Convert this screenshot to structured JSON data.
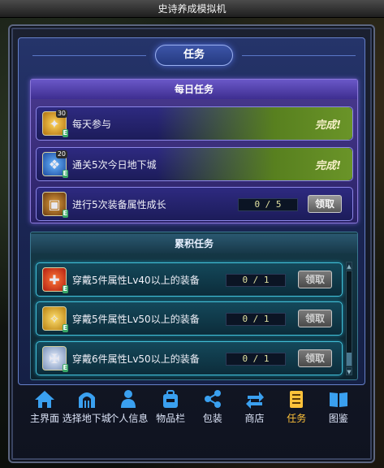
{
  "window": {
    "title": "史诗养成模拟机"
  },
  "panel": {
    "title": "任务"
  },
  "daily": {
    "title": "每日任务",
    "rows": [
      {
        "label": "每天参与",
        "badge": "30",
        "icon": "gold-coin-icon",
        "status": "完成!"
      },
      {
        "label": "通关5次今日地下城",
        "badge": "20",
        "icon": "blue-rune-icon",
        "status": "完成!"
      },
      {
        "label": "进行5次装备属性成长",
        "icon": "equipment-chest-icon",
        "progress": "0 / 5",
        "button": "领取"
      }
    ]
  },
  "accum": {
    "title": "累积任务",
    "rows": [
      {
        "label": "穿戴5件属性Lv40以上的装备",
        "icon": "red-gift-box-icon",
        "progress": "0 / 1",
        "button": "领取"
      },
      {
        "label": "穿戴5件属性Lv50以上的装备",
        "icon": "gold-armor-icon",
        "progress": "0 / 1",
        "button": "领取"
      },
      {
        "label": "穿戴6件属性Lv50以上的装备",
        "icon": "silver-crest-icon",
        "progress": "0 / 1",
        "button": "领取"
      }
    ]
  },
  "nav": [
    {
      "label": "主界面",
      "icon": "home-icon"
    },
    {
      "label": "选择地下城",
      "icon": "dungeon-gate-icon"
    },
    {
      "label": "个人信息",
      "icon": "person-icon"
    },
    {
      "label": "物品栏",
      "icon": "backpack-icon"
    },
    {
      "label": "包装",
      "icon": "share-icon"
    },
    {
      "label": "商店",
      "icon": "swap-arrows-icon"
    },
    {
      "label": "任务",
      "icon": "scroll-icon",
      "active": true
    },
    {
      "label": "图鉴",
      "icon": "book-icon"
    }
  ],
  "colors": {
    "active_nav": "#ffc23a",
    "complete_green": "#6a9428",
    "daily_border": "#8c86e8",
    "accum_border": "#43c0d8"
  }
}
